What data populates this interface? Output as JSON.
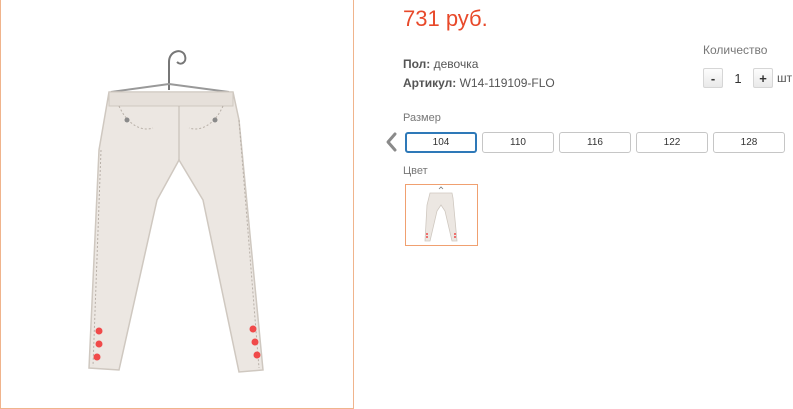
{
  "product": {
    "price": "731 руб.",
    "gender_label": "Пол:",
    "gender_value": "девочка",
    "sku_label": "Артикул:",
    "sku_value": "W14-119109-FLO",
    "image_icon": "jeans-photo"
  },
  "quantity": {
    "label": "Количество",
    "minus": "-",
    "value": "1",
    "plus": "+",
    "unit": "шт"
  },
  "size": {
    "label": "Размер",
    "prev_icon": "chevron-left-icon",
    "options": [
      "104",
      "110",
      "116",
      "122",
      "128"
    ],
    "selected": "104"
  },
  "color": {
    "label": "Цвет",
    "swatch_icon": "jeans-thumbnail"
  },
  "colors": {
    "price": "#e8492a",
    "selected_border": "#2e79b8",
    "photo_border": "#f0b48c"
  }
}
